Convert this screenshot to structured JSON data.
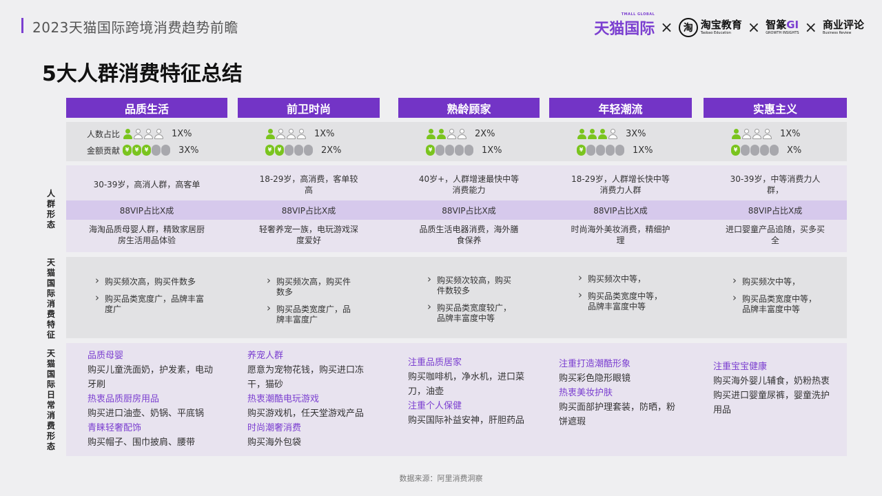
{
  "header": {
    "report_title": "2023天猫国际跨境消费趋势前瞻",
    "logos": {
      "tmall": "天猫国际",
      "tmall_sub": "TMALL GLOBAL",
      "times": "×",
      "taobao_mark": "淘",
      "taobao": "淘宝教育",
      "taobao_en": "Taobao Education",
      "zhimeng": "智篆",
      "zhimeng_gi": "GI",
      "zhimeng_en": "GROWTH INSIGHTS",
      "business": "商业评论",
      "business_en": "Business Review"
    }
  },
  "page_title": "5大人群消费特征总结",
  "side_labels": {
    "group_form": "人群形态",
    "tmall_intl": "天猫国际消费特征",
    "daily": "天猫国际日常消费形态"
  },
  "stat_labels": {
    "people": "人数占比",
    "amount": "金额贡献"
  },
  "colors": {
    "accent": "#7334c6",
    "green": "#7ac41e",
    "highlight": "#7b3fd0"
  },
  "columns": [
    {
      "name": "品质生活",
      "people_ratio": "1X%",
      "people_filled": 1,
      "amount_ratio": "3X%",
      "amount_filled": 3,
      "profile": "30-39岁，高消人群，高客单",
      "vip": "88VIP占比X成",
      "desc": "海淘品质母婴人群，精致家居厨房生活用品体验",
      "features": [
        "购买频次高，购买件数多",
        "购买品类宽度广，品牌丰富度广"
      ],
      "daily": [
        {
          "h": "品质母婴",
          "t": "购买儿童洗面奶，护发素，电动牙刷"
        },
        {
          "h": "热衷品质厨房用品",
          "t": "购买进口油壶、奶锅、平底锅"
        },
        {
          "h": "青睐轻奢配饰",
          "t": "购买帽子、围巾披肩、腰带"
        }
      ]
    },
    {
      "name": "前卫时尚",
      "people_ratio": "1X%",
      "people_filled": 1,
      "amount_ratio": "2X%",
      "amount_filled": 2,
      "profile": "18-29岁，高消费，客单较高",
      "vip": "88VIP占比X成",
      "desc": "轻奢养宠一族，电玩游戏深度爱好",
      "features": [
        "购买频次高，购买件数多",
        "购买品类宽度广，品牌丰富度广"
      ],
      "daily": [
        {
          "h": "养宠人群",
          "t": "愿意为宠物花钱，购买进口冻干，猫砂"
        },
        {
          "h": "热衷潮酷电玩游戏",
          "t": "购买游戏机，任天堂游戏产品"
        },
        {
          "h": "时尚潮奢消费",
          "t": "购买海外包袋"
        }
      ]
    },
    {
      "name": "熟龄顾家",
      "people_ratio": "2X%",
      "people_filled": 2,
      "amount_ratio": "1X%",
      "amount_filled": 1,
      "profile": "40岁+，人群增速最快中等消费能力",
      "vip": "88VIP占比X成",
      "desc": "品质生活电器消费，海外膳食保养",
      "features": [
        "购买频次较高，购买件数较多",
        "购买品类宽度较广，品牌丰富度中等"
      ],
      "daily": [
        {
          "h": "注重品质居家",
          "t": "购买咖啡机，净水机，进口菜刀，油壶"
        },
        {
          "h": "注重个人保健",
          "t": "购买国际补益安神，肝胆药品"
        }
      ]
    },
    {
      "name": "年轻潮流",
      "people_ratio": "3X%",
      "people_filled": 3,
      "amount_ratio": "1X%",
      "amount_filled": 1,
      "profile": "18-29岁，人群增长快中等消费力人群",
      "vip": "88VIP占比X成",
      "desc": "时尚海外美妆消费，精细护理",
      "features": [
        "购买频次中等，",
        "购买品类宽度中等，品牌丰富度中等"
      ],
      "daily": [
        {
          "h": "注重打造潮酷形象",
          "t": "购买彩色隐形眼镜"
        },
        {
          "h": "热衷美妆护肤",
          "t": "购买面部护理套装，防晒，粉饼遮瑕"
        }
      ]
    },
    {
      "name": "实惠主义",
      "people_ratio": "1X%",
      "people_filled": 1,
      "amount_ratio": "X%",
      "amount_filled": 1,
      "profile": "30-39岁，中等消费力人群，",
      "vip": "88VIP占比X成",
      "desc": "进口婴童产品追随，买多买全",
      "features": [
        "购买频次中等，",
        "购买品类宽度中等，品牌丰富度中等"
      ],
      "daily": [
        {
          "h": "注重宝宝健康",
          "t": "购买海外婴儿辅食，奶粉热衷购买进口婴童尿裤，婴童洗护用品"
        }
      ]
    }
  ],
  "footer": "数据来源：阿里消费洞察"
}
